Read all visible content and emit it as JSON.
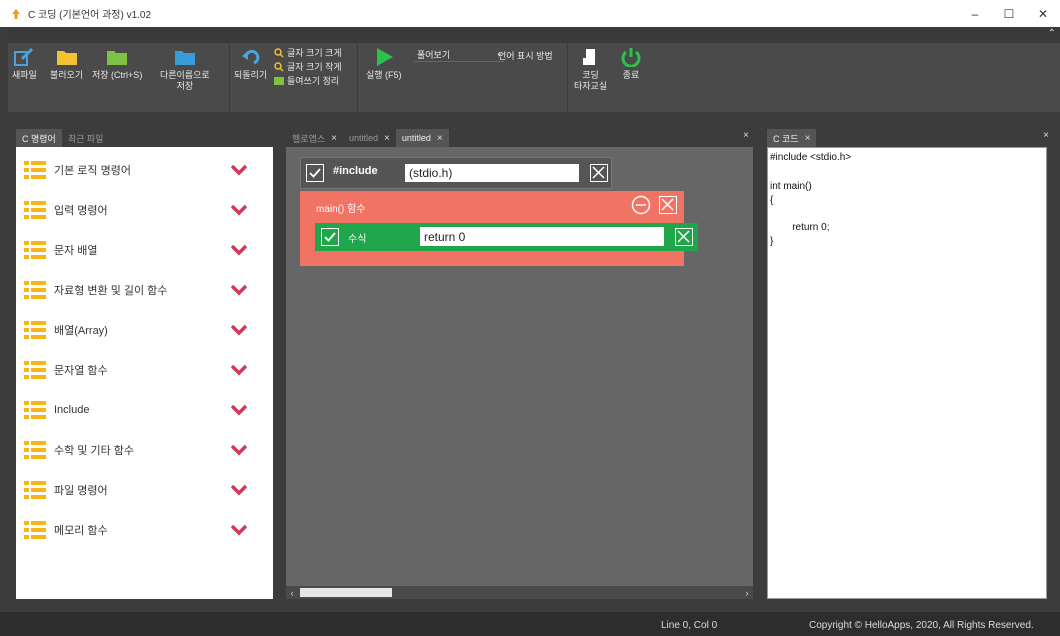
{
  "window": {
    "title": "C 코딩 (기본언어 과정) v1.02",
    "controls": [
      "–",
      "☐",
      "✕"
    ]
  },
  "toolbar": {
    "new_file": "새파일",
    "open": "불러오기",
    "save": "저장 (Ctrl+S)",
    "save_as_line1": "다른이름으로",
    "save_as_line2": "저장",
    "undo": "되돌리기",
    "font_larger": "글자 크기 크게",
    "font_smaller": "글자 크기 작게",
    "indent_cleanup": "들여쓰기 정리",
    "run": "실행 (F5)",
    "view_select": "풀어보기",
    "language_display": "언어 표시 방법",
    "typing_line1": "코딩",
    "typing_line2": "타자교실",
    "exit": "종료"
  },
  "left_panel": {
    "tabs": [
      "C 명령어",
      "최근 파일"
    ],
    "categories": [
      "기본 로직 명령어",
      "입력 명령어",
      "문자 배열",
      "자료형 변환 및 길이 함수",
      "배열(Array)",
      "문자열 함수",
      "Include",
      "수학 및 기타 함수",
      "파일 명령어",
      "메모리 함수"
    ]
  },
  "center_panel": {
    "tabs": [
      "헬로앱스",
      "untitled",
      "untitled"
    ],
    "close_all": "×",
    "blocks": {
      "include_label": "#include",
      "include_value": "(stdio.h)",
      "main_label": "main() 함수",
      "expr_label": "수식",
      "expr_value": "return 0"
    }
  },
  "right_panel": {
    "tab": "C 코드",
    "close": "×",
    "code": [
      "#include <stdio.h>",
      "",
      "int main()",
      "{",
      "        return 0;",
      "}"
    ]
  },
  "status": {
    "position": "Line 0, Col 0",
    "copyright": "Copyright © HelloApps, 2020, All Rights Reserved."
  },
  "colors": {
    "main_block": "#f07363",
    "expr_block": "#1fa64a",
    "category_icon": "#f7b518",
    "chevron": "#d4375a",
    "folder": "#f2c232",
    "run": "#2bc24d",
    "power": "#2bc24d"
  }
}
